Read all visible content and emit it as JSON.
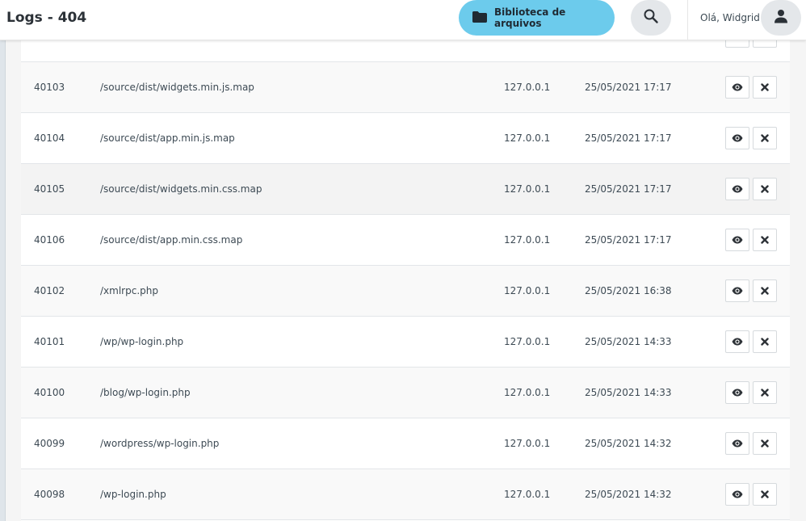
{
  "header": {
    "title": "Logs - 404",
    "library_label": "Biblioteca de arquivos",
    "greeting": "Olá, Widgrid"
  },
  "icons": {
    "folder": "folder-icon",
    "search": "search-icon",
    "user": "user-icon",
    "view": "eye-icon",
    "delete": "close-icon"
  },
  "colors": {
    "accent": "#6ccbec",
    "icon_bg": "#e4e7ea"
  },
  "rows": [
    {
      "id": "40103",
      "url": "/source/dist/widgets.min.js.map",
      "ip": "127.0.0.1",
      "date": "25/05/2021 17:17"
    },
    {
      "id": "40104",
      "url": "/source/dist/app.min.js.map",
      "ip": "127.0.0.1",
      "date": "25/05/2021 17:17"
    },
    {
      "id": "40105",
      "url": "/source/dist/widgets.min.css.map",
      "ip": "127.0.0.1",
      "date": "25/05/2021 17:17"
    },
    {
      "id": "40106",
      "url": "/source/dist/app.min.css.map",
      "ip": "127.0.0.1",
      "date": "25/05/2021 17:17"
    },
    {
      "id": "40102",
      "url": "/xmlrpc.php",
      "ip": "127.0.0.1",
      "date": "25/05/2021 16:38"
    },
    {
      "id": "40101",
      "url": "/wp/wp-login.php",
      "ip": "127.0.0.1",
      "date": "25/05/2021 14:33"
    },
    {
      "id": "40100",
      "url": "/blog/wp-login.php",
      "ip": "127.0.0.1",
      "date": "25/05/2021 14:33"
    },
    {
      "id": "40099",
      "url": "/wordpress/wp-login.php",
      "ip": "127.0.0.1",
      "date": "25/05/2021 14:32"
    },
    {
      "id": "40098",
      "url": "/wp-login.php",
      "ip": "127.0.0.1",
      "date": "25/05/2021 14:32"
    }
  ]
}
